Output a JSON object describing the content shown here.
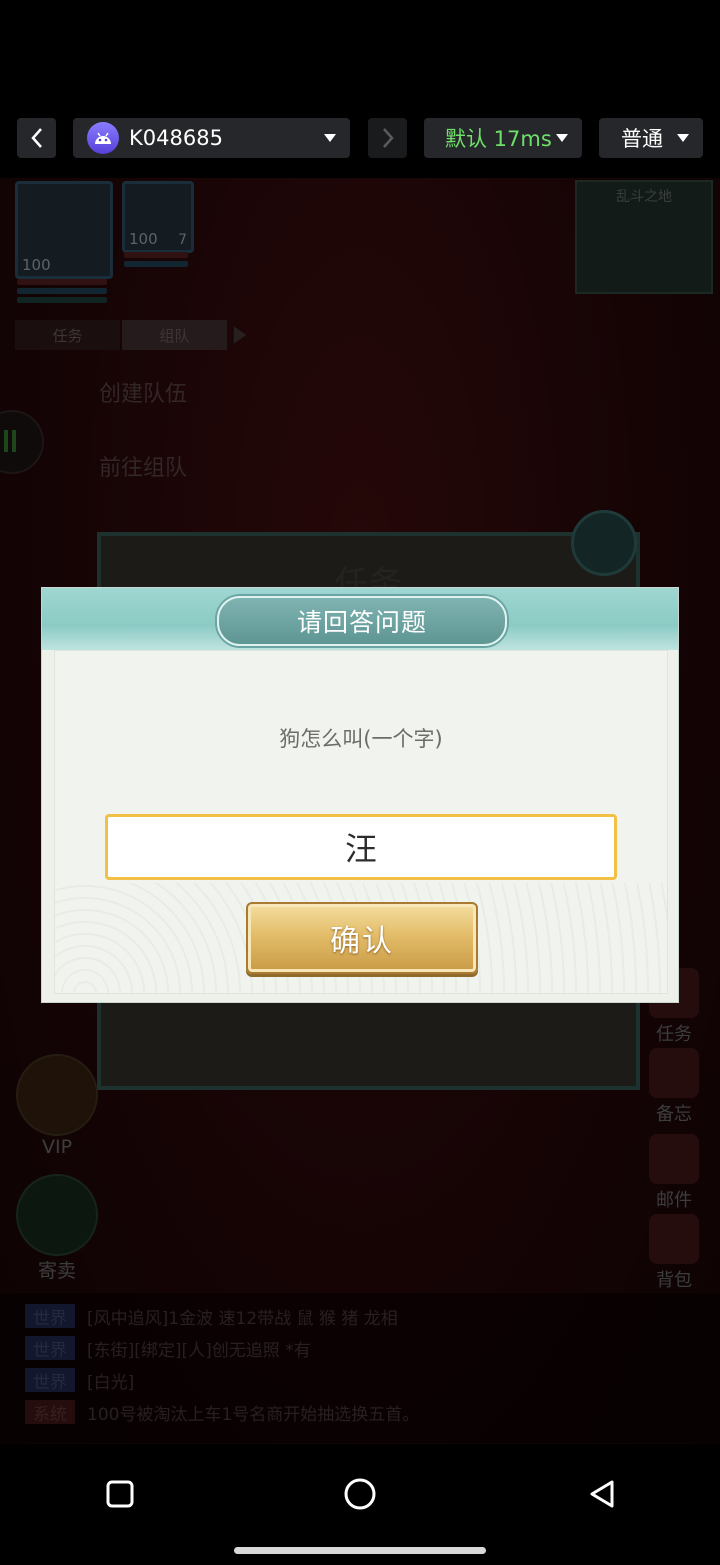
{
  "topbar": {
    "device_name": "K048685",
    "latency_label": "默认 17ms",
    "mode_label": "普通"
  },
  "game": {
    "hero_levels": [
      "100",
      "100"
    ],
    "hero_slot_count": "7",
    "tabs": [
      "任务",
      "组队"
    ],
    "side_menu": [
      "创建队伍",
      "前往组队"
    ],
    "minimap_label": "乱斗之地",
    "left_icons": [
      "VIP",
      "寄卖"
    ],
    "right_icons": [
      "任务",
      "备忘",
      "邮件",
      "背包"
    ],
    "bg_panel_title": "任务",
    "chat": [
      {
        "tag": "世界",
        "text": "[风中追风]1金波 速12带战 鼠 猴 猪 龙相"
      },
      {
        "tag": "世界",
        "text": "[东街][绑定][人]创无追照 *有"
      },
      {
        "tag": "世界",
        "text": "[白光]"
      },
      {
        "tag": "系统",
        "text": "100号被淘汰上车1号名商开始抽选换五首。"
      }
    ]
  },
  "dialog": {
    "title": "请回答问题",
    "question": "狗怎么叫(一个字)",
    "answer_value": "汪",
    "confirm_label": "确认"
  },
  "colors": {
    "accent_green": "#6fe06a",
    "dialog_header": "#8ccbc5",
    "input_border": "#f2c045",
    "confirm_gold": "#e3bd6a"
  }
}
